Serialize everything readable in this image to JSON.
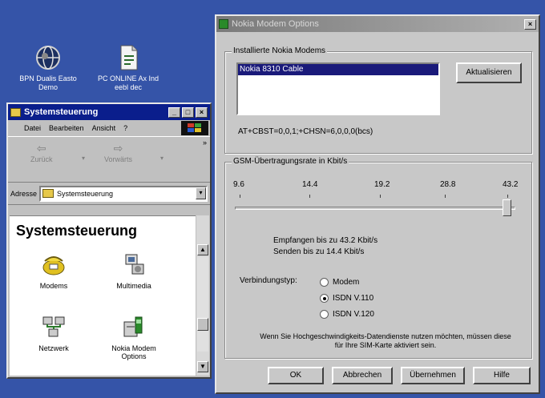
{
  "desktop": {
    "icons": [
      {
        "label": "BPN Dualis Easto Demo",
        "icon": "globe-icon"
      },
      {
        "label": "PC ONLINE Ax Ind eebl dec",
        "icon": "document-icon"
      }
    ]
  },
  "control_panel": {
    "title": "Systemsteuerung",
    "menu": [
      "Datei",
      "Bearbeiten",
      "Ansicht",
      "?"
    ],
    "back_label": "Zurück",
    "forward_label": "Vorwärts",
    "address_label": "Adresse",
    "address_value": "Systemsteuerung",
    "heading": "Systemsteuerung",
    "items": [
      {
        "label": "Modems",
        "icon": "telephone-icon"
      },
      {
        "label": "Multimedia",
        "icon": "multimedia-icon"
      },
      {
        "label": "Netzwerk",
        "icon": "network-icon"
      },
      {
        "label": "Nokia Modem Options",
        "icon": "nokia-modem-icon"
      }
    ]
  },
  "dialog": {
    "title": "Nokia Modem Options",
    "close": "×",
    "installed_group": "Installierte Nokia Modems",
    "modems": [
      "Nokia 8310 Cable"
    ],
    "refresh_button": "Aktualisieren",
    "init_string": "AT+CBST=0,0,1;+CHSN=6,0,0,0(bcs)",
    "speed_group": "GSM-Übertragungsrate in Kbit/s",
    "speed_ticks": [
      "9.6",
      "14.4",
      "19.2",
      "28.8",
      "43.2"
    ],
    "speed_value": 43.2,
    "receive_text": "Empfangen bis zu 43.2 Kbit/s",
    "send_text": "Senden bis zu 14.4 Kbit/s",
    "connection_label": "Verbindungstyp:",
    "connection_options": [
      "Modem",
      "ISDN V.110",
      "ISDN V.120"
    ],
    "connection_selected": "ISDN V.110",
    "note": "Wenn Sie Hochgeschwindigkeits-Datendienste nutzen möchten, müssen diese für Ihre SIM-Karte aktiviert sein.",
    "buttons": {
      "ok": "OK",
      "cancel": "Abbrechen",
      "apply": "Übernehmen",
      "help": "Hilfe"
    }
  },
  "colors": {
    "titlebar_active": "#0a1e8c",
    "desktop": "#3554a8",
    "selection": "#1a1a7a"
  }
}
